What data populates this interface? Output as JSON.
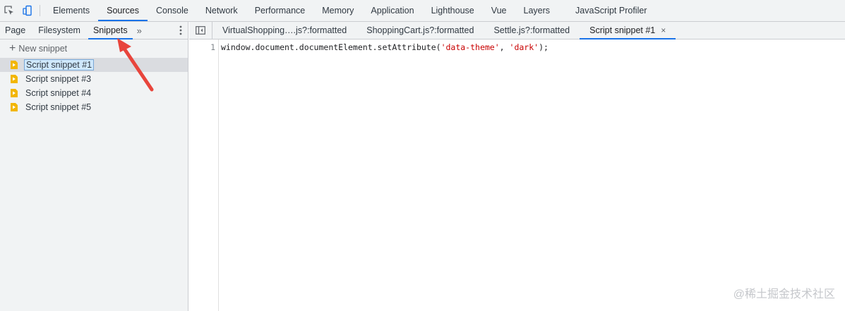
{
  "toolbar": {
    "tabs": [
      "Elements",
      "Sources",
      "Console",
      "Network",
      "Performance",
      "Memory",
      "Application",
      "Lighthouse",
      "Vue",
      "Layers",
      "JavaScript Profiler"
    ],
    "active_tab": "Sources"
  },
  "navigator": {
    "tabs": [
      "Page",
      "Filesystem",
      "Snippets"
    ],
    "more": "»",
    "new_snippet_label": "New snippet",
    "snippets": [
      "Script snippet #1",
      "Script snippet #3",
      "Script snippet #4",
      "Script snippet #5"
    ],
    "selected_snippet": "Script snippet #1"
  },
  "editor": {
    "tabs": [
      "VirtualShopping….js?:formatted",
      "ShoppingCart.js?:formatted",
      "Settle.js?:formatted",
      "Script snippet #1"
    ],
    "active_tab": "Script snippet #1",
    "close": "×",
    "line_number": "1",
    "code": {
      "prefix": "window.document.documentElement.setAttribute(",
      "arg1": "'data-theme'",
      "sep": ", ",
      "arg2": "'dark'",
      "suffix": ");"
    }
  },
  "watermark": "@稀土掘金技术社区",
  "colors": {
    "accent": "#1a73e8",
    "string": "#c80000",
    "arrow": "#e8453c"
  }
}
